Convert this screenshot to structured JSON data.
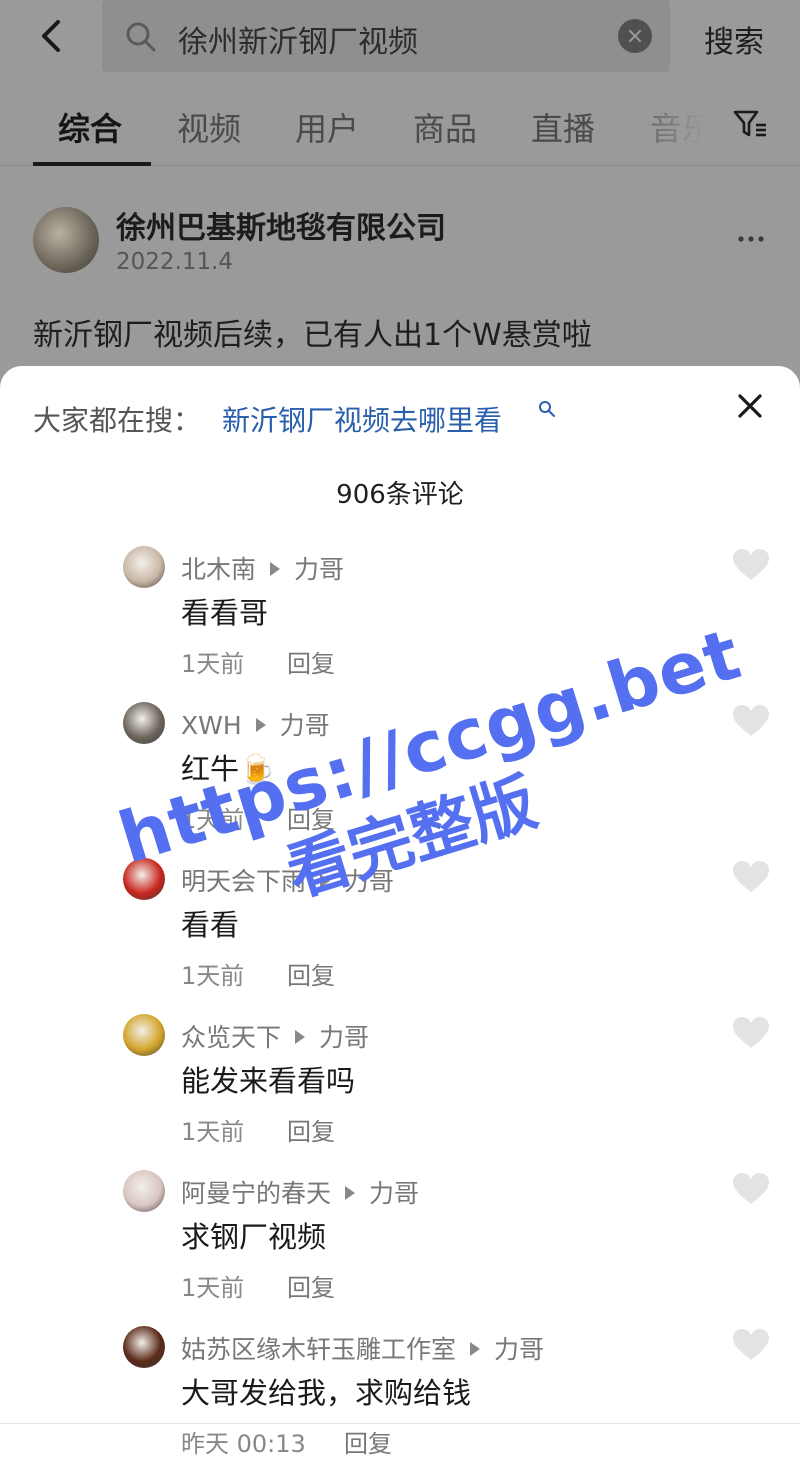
{
  "search": {
    "query": "徐州新沂钢厂视频",
    "button_label": "搜索"
  },
  "tabs": [
    {
      "label": "综合"
    },
    {
      "label": "视频"
    },
    {
      "label": "用户"
    },
    {
      "label": "商品"
    },
    {
      "label": "直播"
    },
    {
      "label": "音乐"
    }
  ],
  "post": {
    "author": "徐州巴基斯地毯有限公司",
    "date": "2022.11.4",
    "text": "新沂钢厂视频后续，已有人出1个W悬赏啦"
  },
  "sheet": {
    "hot_search_label": "大家都在搜：",
    "hot_search_link": "新沂钢厂视频去哪里看",
    "comment_count": "906条评论"
  },
  "comments": [
    {
      "user": "北木南",
      "reply_to": "力哥",
      "text": "看看哥",
      "time": "1天前",
      "reply_label": "回复",
      "avatar_color": "#c9b8a6"
    },
    {
      "user": "XWH",
      "reply_to": "力哥",
      "text": "红牛🍺",
      "time": "1天前",
      "reply_label": "回复",
      "avatar_color": "#6d655c"
    },
    {
      "user": "明天会下雨",
      "reply_to": "力哥",
      "text": "看看",
      "time": "1天前",
      "reply_label": "回复",
      "avatar_color": "#c8261e"
    },
    {
      "user": "众览天下",
      "reply_to": "力哥",
      "text": "能发来看看吗",
      "time": "1天前",
      "reply_label": "回复",
      "avatar_color": "#d4a52c"
    },
    {
      "user": "阿曼宁的春天",
      "reply_to": "力哥",
      "text": "求钢厂视频",
      "time": "1天前",
      "reply_label": "回复",
      "avatar_color": "#d9c6c0"
    },
    {
      "user": "姑苏区缘木轩玉雕工作室",
      "reply_to": "力哥",
      "text": "大哥发给我，求购给钱",
      "time": "昨天 00:13",
      "reply_label": "回复",
      "avatar_color": "#5a2a18"
    }
  ],
  "watermark": {
    "line1": "https://ccgg.bet",
    "line2": "看完整版",
    "color": "#5470f0"
  }
}
